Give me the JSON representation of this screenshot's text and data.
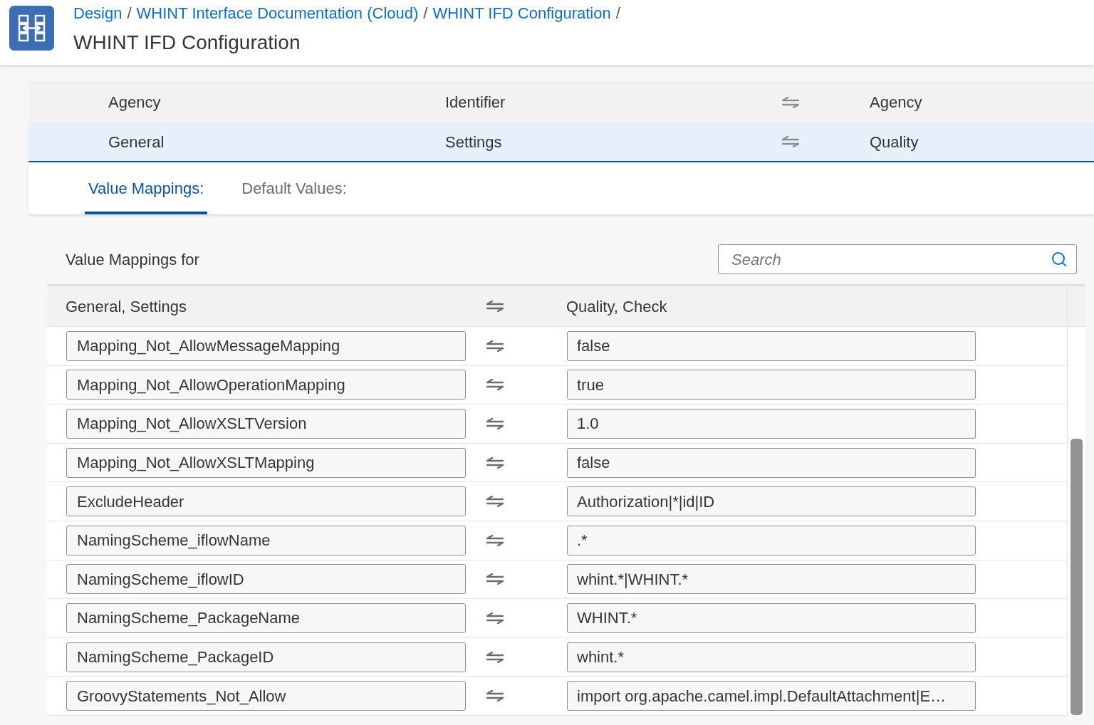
{
  "header": {
    "breadcrumb": [
      {
        "label": "Design",
        "separator": "/"
      },
      {
        "label": "WHINT Interface Documentation (Cloud)",
        "separator": "/"
      },
      {
        "label": "WHINT IFD Configuration",
        "separator": "/"
      }
    ],
    "title": "WHINT IFD Configuration"
  },
  "agency_table": {
    "rows": [
      {
        "cells": [
          "Agency",
          "Identifier",
          "Agency"
        ],
        "selected": false
      },
      {
        "cells": [
          "General",
          "Settings",
          "Quality"
        ],
        "selected": true
      }
    ]
  },
  "tabs": [
    {
      "label": "Value Mappings:",
      "selected": true
    },
    {
      "label": "Default Values:",
      "selected": false
    }
  ],
  "value_mappings": {
    "title": "Value Mappings for",
    "search": {
      "placeholder": "Search"
    },
    "columns": [
      "General, Settings",
      "Quality, Check"
    ],
    "rows": [
      {
        "source": "Mapping_Not_AllowMessageMapping",
        "target": "false"
      },
      {
        "source": "Mapping_Not_AllowOperationMapping",
        "target": "true"
      },
      {
        "source": "Mapping_Not_AllowXSLTVersion",
        "target": "1.0"
      },
      {
        "source": "Mapping_Not_AllowXSLTMapping",
        "target": "false"
      },
      {
        "source": "ExcludeHeader",
        "target": "Authorization|*|id|ID"
      },
      {
        "source": "NamingScheme_iflowName",
        "target": ".*"
      },
      {
        "source": "NamingScheme_iflowID",
        "target": "whint.*|WHINT.*"
      },
      {
        "source": "NamingScheme_PackageName",
        "target": "WHINT.*"
      },
      {
        "source": "NamingScheme_PackageID",
        "target": "whint.*"
      },
      {
        "source": "GroovyStatements_Not_Allow",
        "target": "import org.apache.camel.impl.DefaultAttachment|E…"
      }
    ]
  }
}
